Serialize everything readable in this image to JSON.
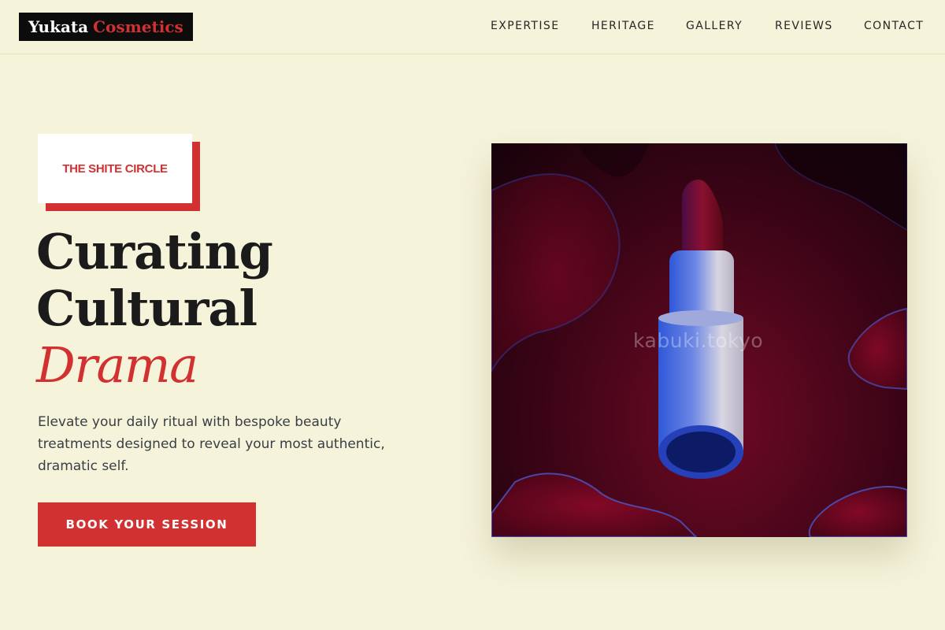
{
  "brand": {
    "name_part1": "Yukata",
    "name_part2": "Cosmetics"
  },
  "nav": {
    "items": [
      "EXPERTISE",
      "HERITAGE",
      "GALLERY",
      "REVIEWS",
      "CONTACT"
    ]
  },
  "hero": {
    "badge": "THE SHITE CIRCLE",
    "headline_line1": "Curating",
    "headline_line2": "Cultural",
    "headline_accent": "Drama",
    "subtext": "Elevate your daily ritual with bespoke beauty treatments designed to reveal your most authentic, dramatic self.",
    "cta_label": "BOOK YOUR SESSION",
    "image_watermark": "kabuki.tokyo",
    "image_subject": "lipstick-in-red-liquid"
  },
  "colors": {
    "accent": "#d23131",
    "background": "#f5f3da",
    "text_dark": "#1b1b1b",
    "text_muted": "#3a3e45",
    "logo_bg": "#0c0c0c"
  }
}
